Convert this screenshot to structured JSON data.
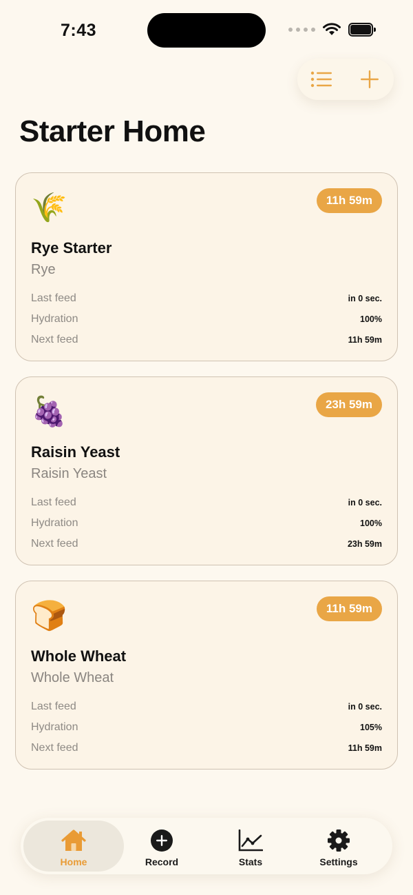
{
  "status_bar": {
    "time": "7:43"
  },
  "page": {
    "title": "Starter Home"
  },
  "labels": {
    "last_feed": "Last feed",
    "hydration": "Hydration",
    "next_feed": "Next feed"
  },
  "starters": [
    {
      "emoji": "🌾",
      "icon": "rice-plant-icon",
      "badge": "11h 59m",
      "name": "Rye Starter",
      "type": "Rye",
      "last_feed": "in 0 sec.",
      "hydration": "100%",
      "next_feed": "11h 59m"
    },
    {
      "emoji": "🍇",
      "icon": "grapes-icon",
      "badge": "23h 59m",
      "name": "Raisin Yeast",
      "type": "Raisin Yeast",
      "last_feed": "in 0 sec.",
      "hydration": "100%",
      "next_feed": "23h 59m"
    },
    {
      "emoji": "🍞",
      "icon": "bread-icon",
      "badge": "11h 59m",
      "name": "Whole Wheat",
      "type": "Whole Wheat",
      "last_feed": "in 0 sec.",
      "hydration": "105%",
      "next_feed": "11h 59m"
    }
  ],
  "tabs": [
    {
      "label": "Home",
      "icon": "house-icon",
      "active": true
    },
    {
      "label": "Record",
      "icon": "plus-circle-icon"
    },
    {
      "label": "Stats",
      "icon": "chart-icon"
    },
    {
      "label": "Settings",
      "icon": "gear-icon"
    }
  ],
  "colors": {
    "accent": "#e9a646",
    "background": "#fdf8ef",
    "card": "#fcf4e7",
    "card_border": "#cfc2b2"
  }
}
